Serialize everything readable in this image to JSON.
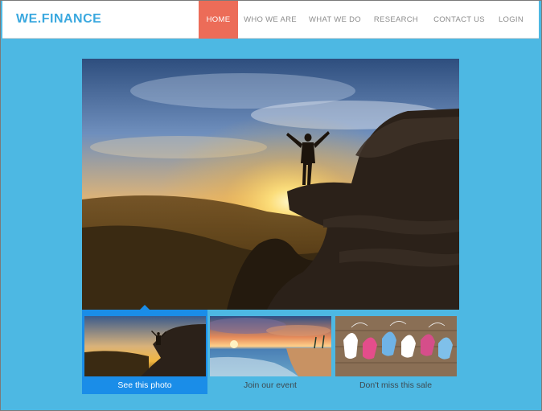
{
  "brand": {
    "logo_text": "WE.FINANCE",
    "color": "#3aa8df"
  },
  "nav": {
    "items": [
      {
        "label": "HOME",
        "active": true
      },
      {
        "label": "WHO WE ARE",
        "active": false
      },
      {
        "label": "WHAT WE DO",
        "active": false
      },
      {
        "label": "RESEARCH",
        "active": false
      },
      {
        "label": "CONTACT US",
        "active": false
      },
      {
        "label": "LOGIN",
        "active": false
      }
    ],
    "active_color": "#ec6c58"
  },
  "hero": {
    "image": "sunset-mountain-person-photo"
  },
  "thumbnails": [
    {
      "image": "sunset-mountain-person-photo",
      "caption": "See this photo",
      "selected": true
    },
    {
      "image": "beach-sunset-photo",
      "caption": "Join our event",
      "selected": false
    },
    {
      "image": "colorful-sneakers-photo",
      "caption": "Don't miss this sale",
      "selected": false
    }
  ],
  "colors": {
    "background": "#4db8e3",
    "selected_thumb": "#1a8de8"
  }
}
